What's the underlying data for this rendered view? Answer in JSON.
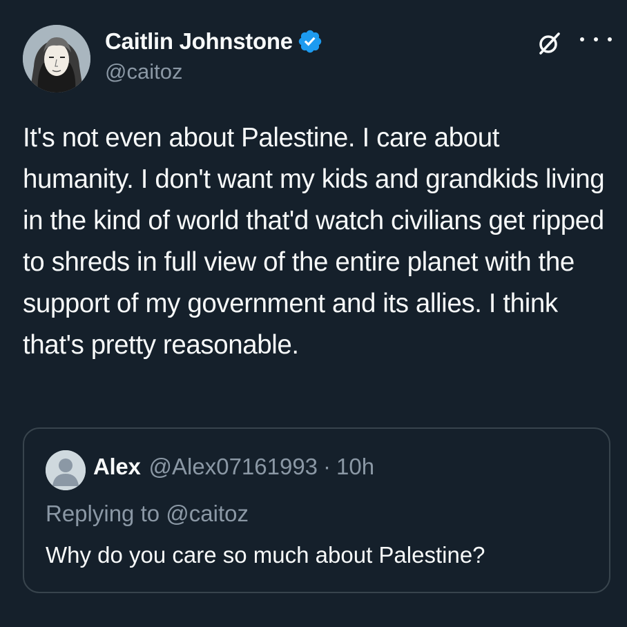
{
  "author": {
    "display_name": "Caitlin Johnstone",
    "handle": "@caitoz",
    "verified": true,
    "avatar_icon": "portrait-avatar"
  },
  "actions": {
    "grok_icon": "grok-icon",
    "more_icon": "more-options-icon"
  },
  "tweet": {
    "text": "It's not even about Palestine. I care about humanity. I don't want my kids and grandkids living in the kind of world that'd watch civilians get ripped to shreds in full view of the entire planet with the support of my government and its allies. I think that's pretty reasonable."
  },
  "quoted_tweet": {
    "display_name": "Alex",
    "handle": "@Alex07161993",
    "separator": "·",
    "time": "10h",
    "replying_to": "Replying to @caitoz",
    "text": "Why do you care so much about Palestine?",
    "avatar_icon": "default-avatar"
  },
  "colors": {
    "background": "#15202b",
    "text_primary": "#f7f9f9",
    "text_secondary": "#8b98a5",
    "verified_blue": "#1d9bf0",
    "border": "#38444d"
  }
}
